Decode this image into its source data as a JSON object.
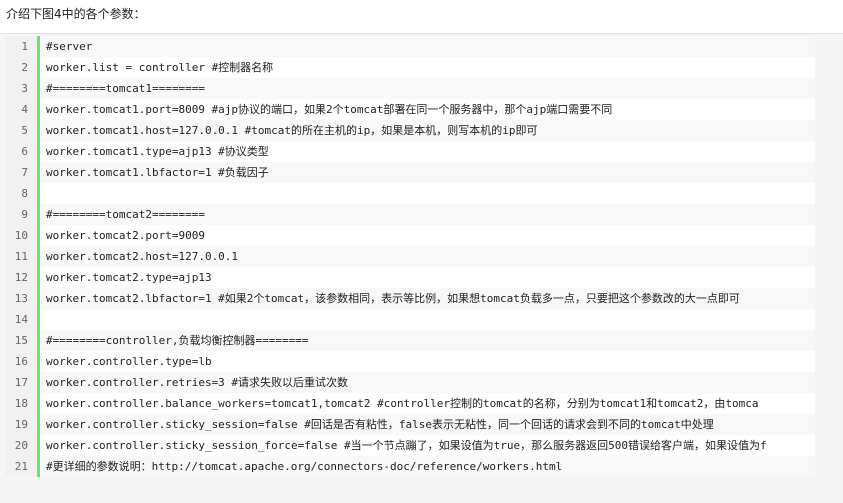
{
  "intro_text": "介绍下图4中的各个参数：",
  "lines": [
    {
      "n": "1",
      "code": "#server"
    },
    {
      "n": "2",
      "code": "worker.list = controller       #控制器名称"
    },
    {
      "n": "3",
      "code": "#========tomcat1========"
    },
    {
      "n": "4",
      "code": "worker.tomcat1.port=8009       #ajp协议的端口，如果2个tomcat部署在同一个服务器中，那个ajp端口需要不同"
    },
    {
      "n": "5",
      "code": "worker.tomcat1.host=127.0.0.1 #tomcat的所在主机的ip，如果是本机，则写本机的ip即可"
    },
    {
      "n": "6",
      "code": "worker.tomcat1.type=ajp13      #协议类型"
    },
    {
      "n": "7",
      "code": "worker.tomcat1.lbfactor=1      #负载因子"
    },
    {
      "n": "8",
      "code": ""
    },
    {
      "n": "9",
      "code": "#========tomcat2========"
    },
    {
      "n": "10",
      "code": "worker.tomcat2.port=9009"
    },
    {
      "n": "11",
      "code": "worker.tomcat2.host=127.0.0.1"
    },
    {
      "n": "12",
      "code": "worker.tomcat2.type=ajp13"
    },
    {
      "n": "13",
      "code": "worker.tomcat2.lbfactor=1     #如果2个tomcat，该参数相同，表示等比例，如果想tomcat负载多一点，只要把这个参数改的大一点即可"
    },
    {
      "n": "14",
      "code": ""
    },
    {
      "n": "15",
      "code": "#========controller,负载均衡控制器========"
    },
    {
      "n": "16",
      "code": "worker.controller.type=lb"
    },
    {
      "n": "17",
      "code": "worker.controller.retries=3  #请求失败以后重试次数"
    },
    {
      "n": "18",
      "code": "worker.controller.balance_workers=tomcat1,tomcat2   #controller控制的tomcat的名称，分别为tomcat1和tomcat2，由tomca"
    },
    {
      "n": "19",
      "code": "worker.controller.sticky_session=false     #回话是否有粘性，false表示无粘性，同一个回话的请求会到不同的tomcat中处理"
    },
    {
      "n": "20",
      "code": "worker.controller.sticky_session_force=false #当一个节点蹦了，如果设值为true，那么服务器返回500错误给客户端，如果设值为f"
    },
    {
      "n": "21",
      "code": "#更详细的参数说明：http://tomcat.apache.org/connectors-doc/reference/workers.html"
    }
  ],
  "colors": {
    "gutter_line": "#6ce26c",
    "number": "#009900",
    "keyword": "#0000cc"
  },
  "scrollbar": {
    "left_icon": "arrow-left-icon",
    "right_icon": "arrow-right-icon"
  }
}
